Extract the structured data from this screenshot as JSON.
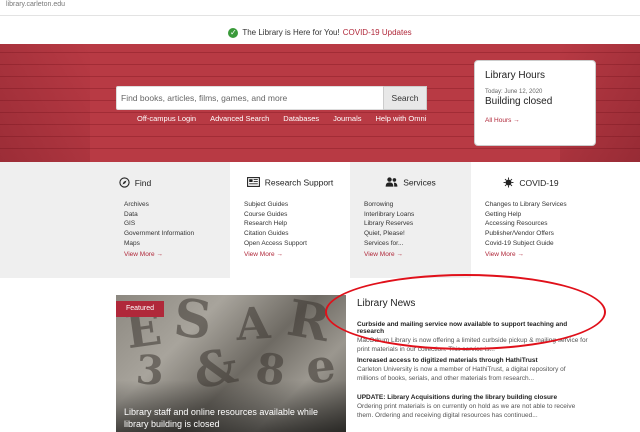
{
  "browser": {
    "url": "library.carleton.edu"
  },
  "notice": {
    "message": "The Library is Here for You!",
    "link": "COVID-19 Updates"
  },
  "search": {
    "placeholder": "Find books, articles, films, games, and more",
    "button": "Search",
    "links": [
      "Off-campus Login",
      "Advanced Search",
      "Databases",
      "Journals",
      "Help with Omni"
    ]
  },
  "hours": {
    "title": "Library Hours",
    "date": "Today: June 12, 2020",
    "status": "Building closed",
    "link": "All Hours →"
  },
  "columns": [
    {
      "title": "Find",
      "icon": "compass-icon",
      "items": [
        "Archives",
        "Data",
        "GIS",
        "Government Information",
        "Maps"
      ],
      "more": "View More →"
    },
    {
      "title": "Research Support",
      "icon": "newspaper-icon",
      "items": [
        "Subject Guides",
        "Course Guides",
        "Research Help",
        "Citation Guides",
        "Open Access Support"
      ],
      "more": "View More →"
    },
    {
      "title": "Services",
      "icon": "users-icon",
      "items": [
        "Borrowing",
        "Interlibrary Loans",
        "Library Reserves",
        "Quiet, Please!",
        "Services for..."
      ],
      "more": "View More →"
    },
    {
      "title": "COVID-19",
      "icon": "virus-icon",
      "items": [
        "Changes to Library Services",
        "Getting Help",
        "Accessing Resources",
        "Publisher/Vendor Offers",
        "Covid-19 Subject Guide"
      ],
      "more": "View More →"
    }
  ],
  "featured": {
    "badge": "Featured",
    "caption": "Library staff and online resources available while library building is closed"
  },
  "news": {
    "title": "Library News",
    "items": [
      {
        "headline": "Curbside and mailing service now available to support teaching and research",
        "text": "MacOdrum Library is now offering a limited curbside pickup & mailing service for print materials in our collection. This service is..."
      },
      {
        "headline": "Increased access to digitized materials through HathiTrust",
        "text": "Carleton University is now a member of HathiTrust, a digital repository of millions of books, serials, and other materials from research..."
      },
      {
        "headline": "UPDATE: Library Acquisitions during the library building closure",
        "text": "Ordering print materials is on currently on hold as we are not able to receive them. Ordering and receiving digital resources has continued..."
      }
    ]
  },
  "colors": {
    "brand": "#b0283a",
    "hero": "#b83a44",
    "annotation": "#e0101a",
    "success": "#3a9a3a"
  }
}
